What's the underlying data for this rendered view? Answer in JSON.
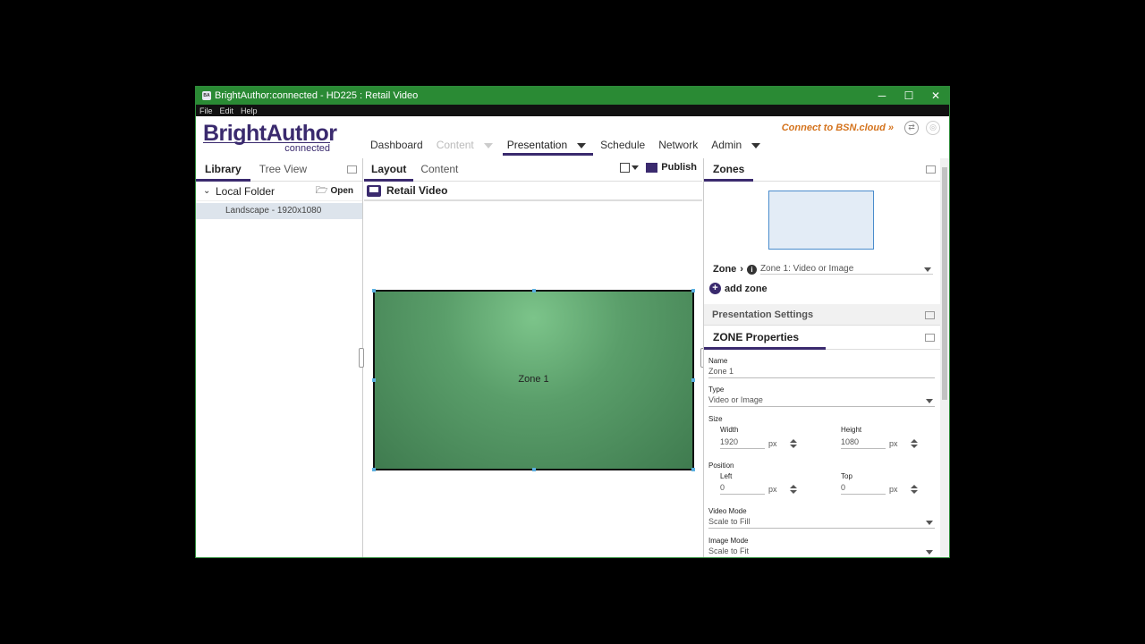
{
  "window": {
    "title": "BrightAuthor:connected - HD225 : Retail Video"
  },
  "menu": [
    "File",
    "Edit",
    "Help"
  ],
  "logo": {
    "line1": "BrightAuthor",
    "line2": "connected"
  },
  "nav": {
    "dashboard": "Dashboard",
    "content": "Content",
    "presentation": "Presentation",
    "schedule": "Schedule",
    "network": "Network",
    "admin": "Admin"
  },
  "bsn_link": "Connect to BSN.cloud »",
  "library": {
    "tab_library": "Library",
    "tab_tree": "Tree View",
    "folder": "Local Folder",
    "open": "Open",
    "item": "Landscape - 1920x1080"
  },
  "editor": {
    "tab_layout": "Layout",
    "tab_content": "Content",
    "publish": "Publish",
    "presentation_name": "Retail Video",
    "zone_label": "Zone 1"
  },
  "zones_panel": {
    "title": "Zones",
    "zone_label": "Zone",
    "zone_select": "Zone 1: Video or Image",
    "add_zone": "add zone",
    "presentation_settings": "Presentation Settings",
    "zone_properties": "ZONE Properties"
  },
  "props": {
    "name_label": "Name",
    "name_value": "Zone 1",
    "type_label": "Type",
    "type_value": "Video or Image",
    "size_label": "Size",
    "width_label": "Width",
    "width_value": "1920",
    "height_label": "Height",
    "height_value": "1080",
    "position_label": "Position",
    "left_label": "Left",
    "left_value": "0",
    "top_label": "Top",
    "top_value": "0",
    "unit": "px",
    "video_mode_label": "Video Mode",
    "video_mode_value": "Scale to Fill",
    "image_mode_label": "Image Mode",
    "image_mode_value": "Scale to Fit"
  },
  "colors": {
    "title_bar": "#2a8a34",
    "brand": "#3a2a6e",
    "bsn_link": "#d4731d",
    "zone_fill": "#5a9e6a"
  }
}
